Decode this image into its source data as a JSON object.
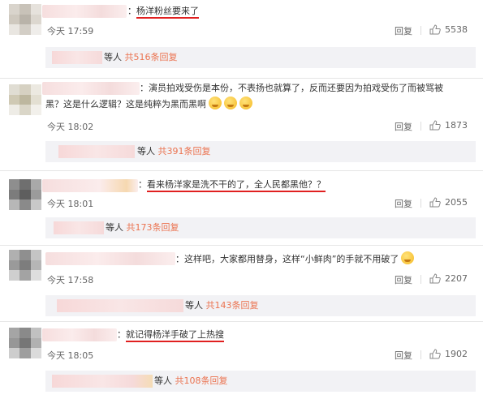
{
  "comments": [
    {
      "text": "杨洋粉丝要来了",
      "time": "今天 17:59",
      "reply": "回复",
      "likes": "5538",
      "sub_prefix": "等人",
      "sub_count": "共516条回复"
    },
    {
      "text_line1": "演员拍戏受伤是本份，不表扬也就算了，反而还要因为拍戏受伤了而被骂被",
      "text_line2": "黑？这是什么逻辑？这是纯粹为黑而黑啊",
      "time": "今天 18:02",
      "reply": "回复",
      "likes": "1873",
      "sub_prefix": "等人",
      "sub_count": "共391条回复"
    },
    {
      "text": "看来杨洋家是洗不干的了，全人民都黑他？？",
      "time": "今天 18:01",
      "reply": "回复",
      "likes": "2055",
      "sub_prefix": "等人",
      "sub_count": "共173条回复"
    },
    {
      "text": "这样吧，大家都用替身，这样“小鲜肉”的手就不用破了",
      "time": "今天 17:58",
      "reply": "回复",
      "likes": "2207",
      "sub_prefix": "等人",
      "sub_count": "共143条回复"
    },
    {
      "text": "就记得杨洋手破了上热搜",
      "time": "今天 18:05",
      "reply": "回复",
      "likes": "1902",
      "sub_prefix": "等人",
      "sub_count": "共108条回复"
    }
  ],
  "colon": "：",
  "colors": {
    "highlight": "#e02020",
    "count": "#eb7350",
    "sub_bg": "#f2f2f5"
  }
}
